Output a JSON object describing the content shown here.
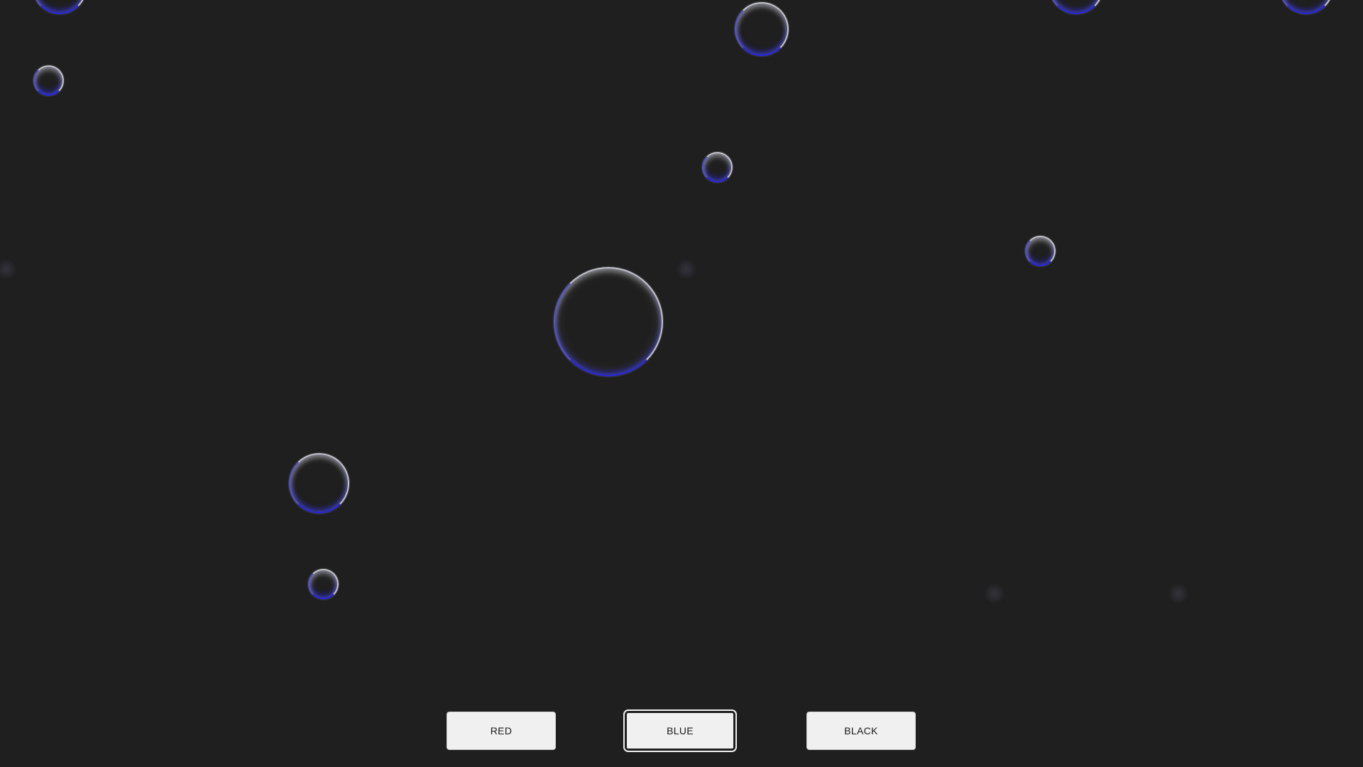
{
  "buttons": [
    {
      "label": "RED",
      "selected": false
    },
    {
      "label": "BLUE",
      "selected": true
    },
    {
      "label": "BLACK",
      "selected": false
    }
  ],
  "colors": {
    "background": "#1f1f1f",
    "bubble_accent": "#2828e6",
    "button_bg": "#f0f0f0"
  }
}
